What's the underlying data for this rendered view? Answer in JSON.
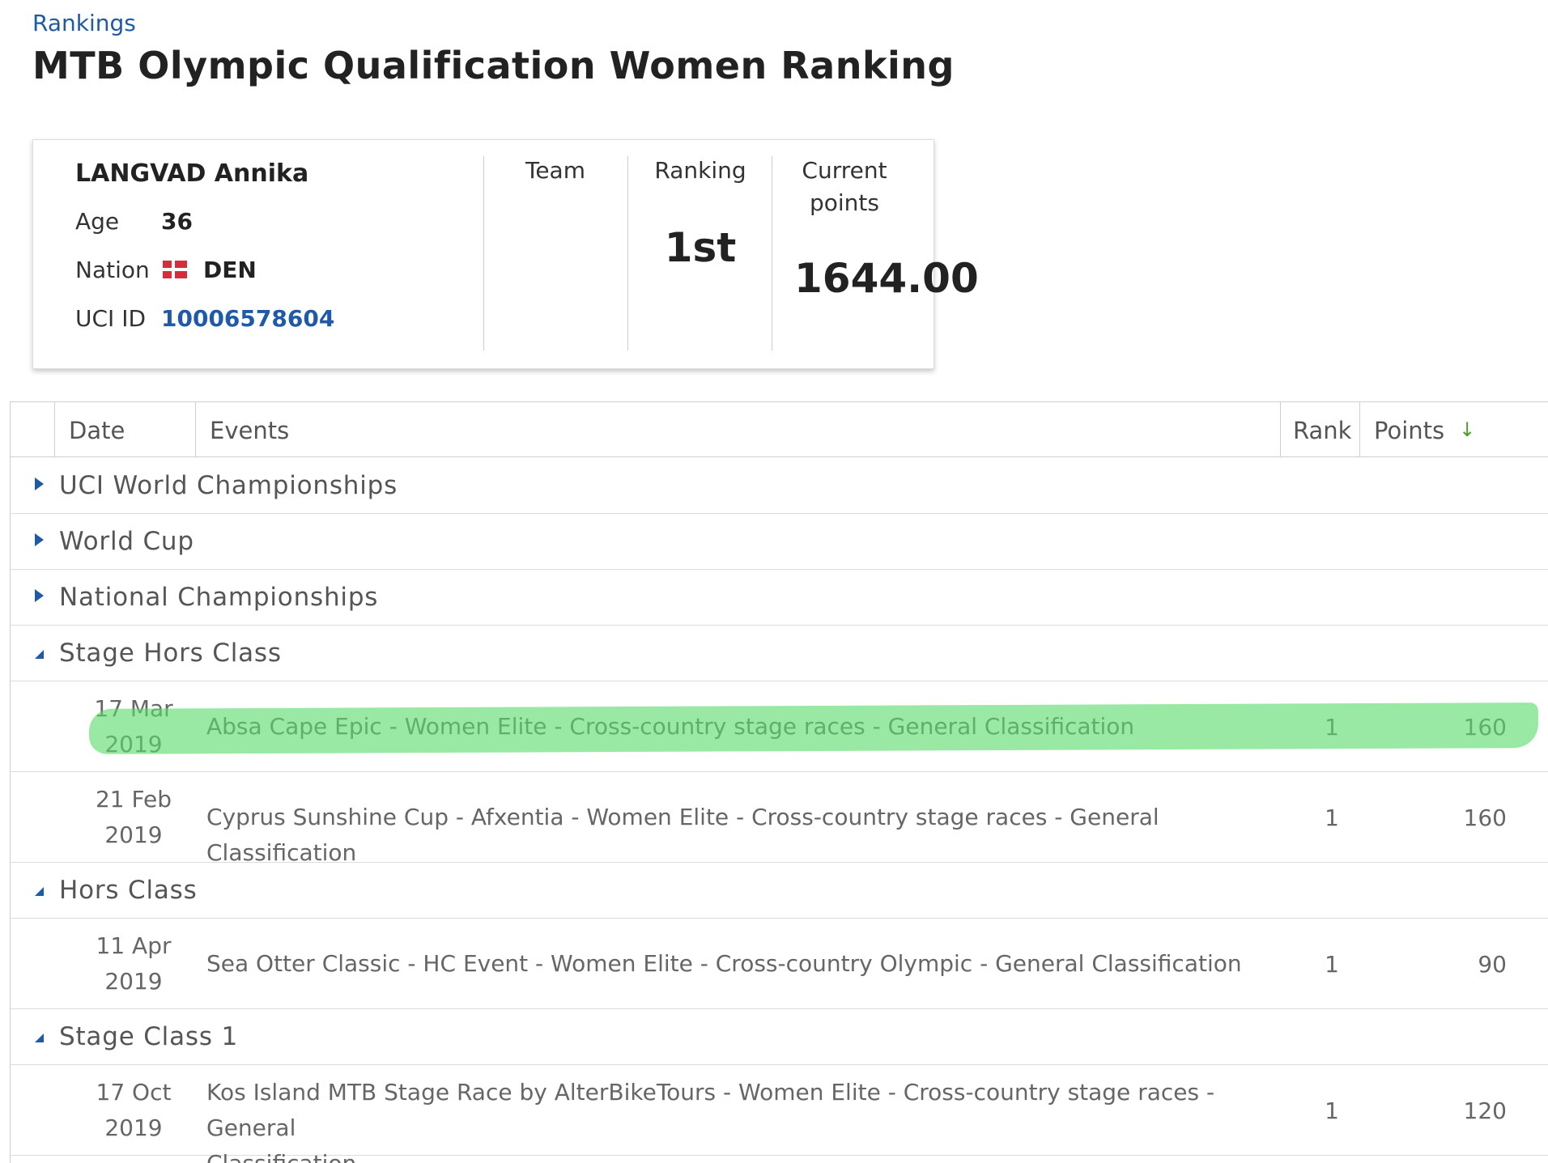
{
  "breadcrumb": "Rankings",
  "page_title": "MTB Olympic Qualification Women Ranking",
  "rider": {
    "name": "LANGVAD Annika",
    "age_label": "Age",
    "age": "36",
    "nation_label": "Nation",
    "nation": "DEN",
    "uci_id_label": "UCI ID",
    "uci_id": "10006578604",
    "team_label": "Team",
    "ranking_label": "Ranking",
    "ranking": "1st",
    "points_label_line1": "Current",
    "points_label_line2": "points",
    "points": "1644.00"
  },
  "table": {
    "headers": {
      "date": "Date",
      "events": "Events",
      "rank": "Rank",
      "points": "Points"
    },
    "groups": [
      {
        "label": "UCI World Championships",
        "expanded": false
      },
      {
        "label": "World Cup",
        "expanded": false
      },
      {
        "label": "National Championships",
        "expanded": false
      },
      {
        "label": "Stage Hors Class",
        "expanded": true
      },
      {
        "label": "Hors Class",
        "expanded": true
      },
      {
        "label": "Stage Class 1",
        "expanded": true
      }
    ],
    "rows": [
      {
        "date_line1": "17 Mar",
        "date_line2": "2019",
        "event": "Absa Cape Epic - Women Elite - Cross-country stage races - General Classification",
        "rank": "1",
        "points": "160",
        "highlighted": true
      },
      {
        "date_line1": "21 Feb",
        "date_line2": "2019",
        "event": "Cyprus Sunshine Cup - Afxentia - Women Elite - Cross-country stage races - General Classification",
        "rank": "1",
        "points": "160"
      },
      {
        "date_line1": "11 Apr",
        "date_line2": "2019",
        "event": "Sea Otter Classic - HC Event - Women Elite - Cross-country Olympic - General Classification",
        "rank": "1",
        "points": "90"
      },
      {
        "date_line1": "17 Oct",
        "date_line2": "2019",
        "event_line1": "Kos Island MTB Stage Race by AlterBikeTours - Women Elite - Cross-country stage races - General",
        "event_line2": "Classification",
        "rank": "1",
        "points": "120"
      }
    ]
  },
  "colors": {
    "link": "#1e5aa8",
    "highlight": "#5adc6e",
    "sort_arrow": "#4f9a28",
    "flag_red": "#d62d3a"
  },
  "icons": {
    "sort": "arrow-down-icon",
    "collapsed": "caret-right-icon",
    "expanded": "caret-up-icon",
    "flag": "denmark-flag-icon"
  }
}
